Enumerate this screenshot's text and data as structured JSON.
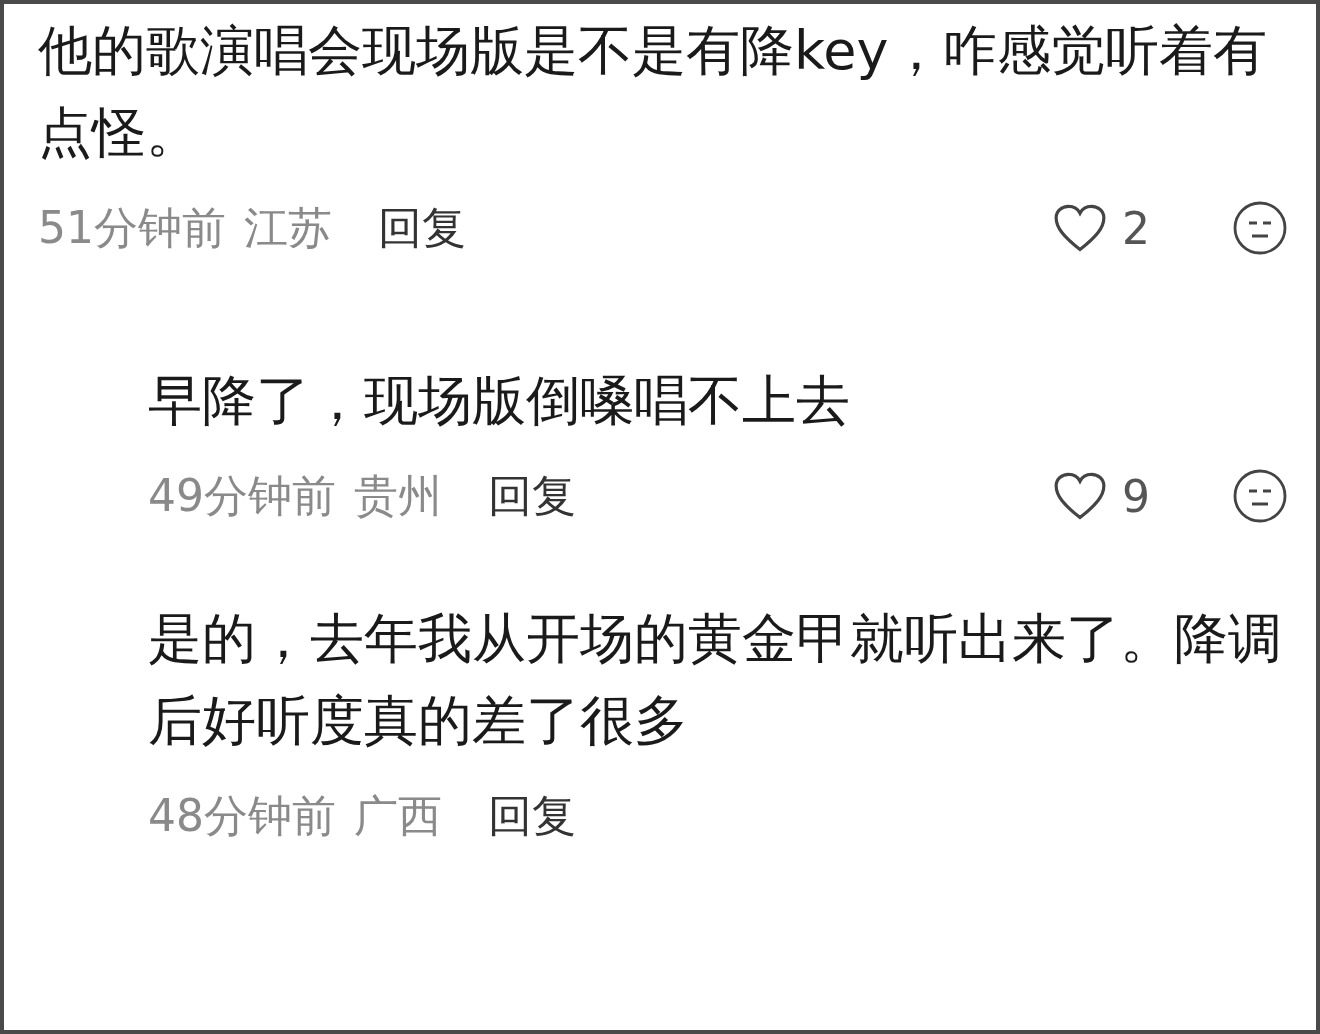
{
  "comments": [
    {
      "text": "他的歌演唱会现场版是不是有降key，咋感觉听着有点怪。",
      "time": "51分钟前",
      "location": "江苏",
      "reply": "回复",
      "likes": "2",
      "replies": [
        {
          "text": "早降了，现场版倒嗓唱不上去",
          "time": "49分钟前",
          "location": "贵州",
          "reply": "回复",
          "likes": "9"
        },
        {
          "text": "是的，去年我从开场的黄金甲就听出来了。降调后好听度真的差了很多",
          "time": "48分钟前",
          "location": "广西",
          "reply": "回复"
        }
      ]
    }
  ]
}
